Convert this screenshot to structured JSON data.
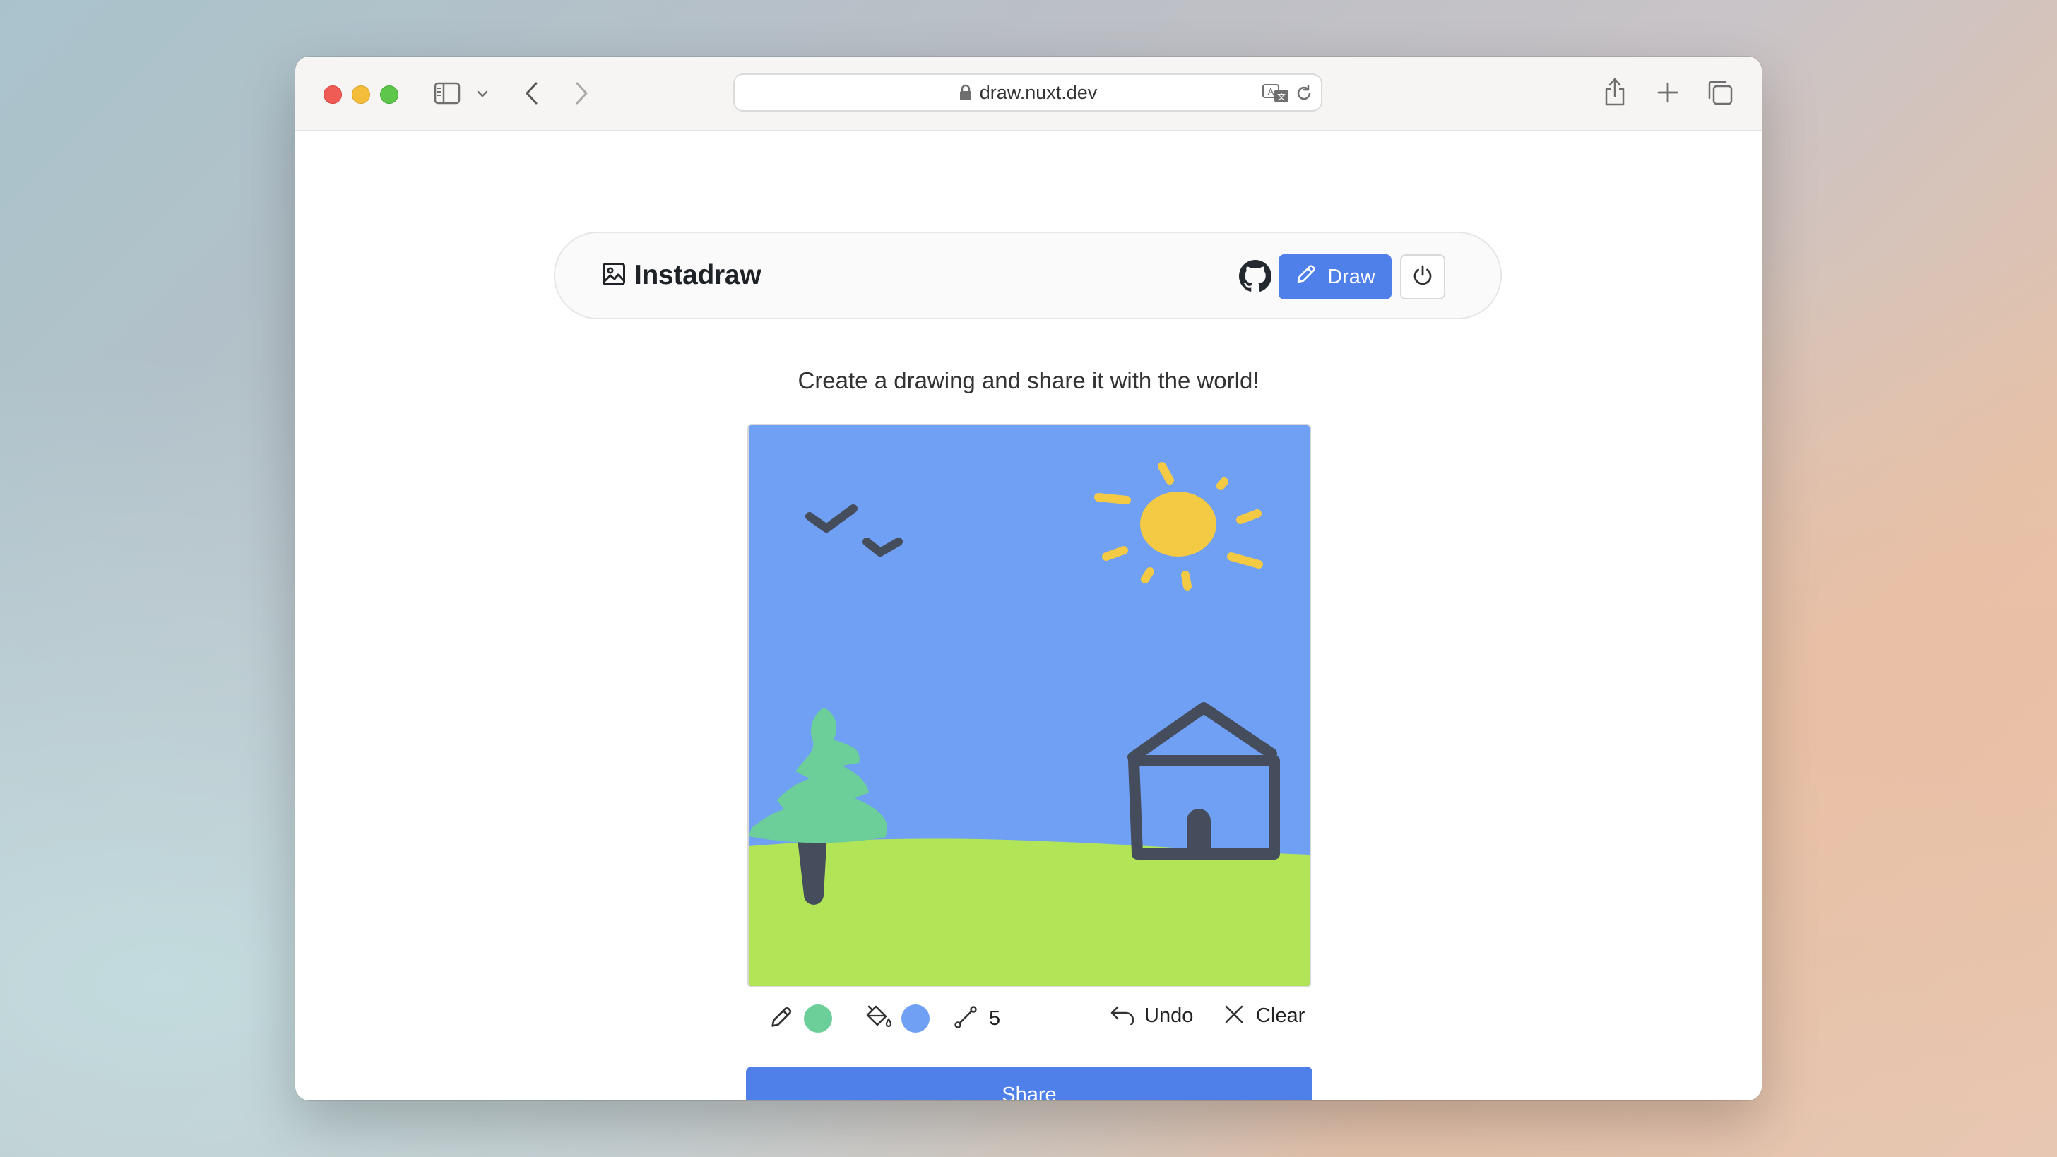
{
  "browser": {
    "url": "draw.nuxt.dev",
    "icons": [
      "sidebar-icon",
      "chevron-down-icon",
      "back-icon",
      "forward-icon",
      "lock-icon",
      "translate-icon",
      "reload-icon",
      "share-icon",
      "new-tab-icon",
      "tabs-overview-icon"
    ]
  },
  "app": {
    "title": "Instadraw",
    "logo_icon": "image-icon",
    "github_icon": "github-icon",
    "draw_label": "Draw",
    "power_icon": "power-icon",
    "tagline": "Create a drawing and share it with the world!"
  },
  "canvas": {
    "subject": "sky, sun, birds, tree, house, grass",
    "colors": {
      "sky": "#6fa0f3",
      "grass": "#b2e458",
      "sun": "#f4c944",
      "tree": "#6cce99",
      "dark": "#454c5c"
    }
  },
  "toolbar": {
    "pen_color": "#6cce99",
    "fill_color": "#6fa0f3",
    "stroke_size": "5",
    "undo_label": "Undo",
    "clear_label": "Clear"
  },
  "share_label": "Share",
  "colors": {
    "accent": "#4f80e9",
    "close": "#ee5c55",
    "minimize": "#f4bd3a",
    "maximize": "#5ec64a"
  }
}
